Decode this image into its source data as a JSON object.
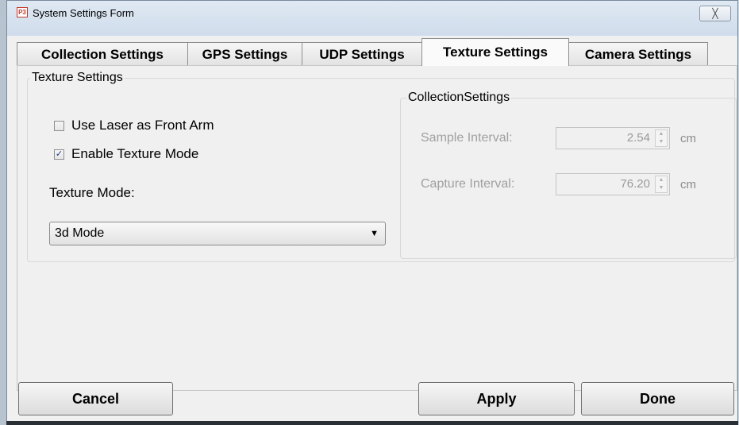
{
  "window": {
    "title": "System Settings Form",
    "app_icon_text": "P3",
    "close_glyph": "╳"
  },
  "tabs": [
    {
      "label": "Collection Settings",
      "active": false
    },
    {
      "label": "GPS Settings",
      "active": false
    },
    {
      "label": "UDP Settings",
      "active": false
    },
    {
      "label": "Texture Settings",
      "active": true
    },
    {
      "label": "Camera Settings",
      "active": false
    }
  ],
  "texture_group": {
    "legend": "Texture Settings",
    "use_laser": {
      "label": "Use Laser as Front Arm",
      "checked": false
    },
    "enable_texture": {
      "label": "Enable Texture Mode",
      "checked": true,
      "check_glyph": "✓"
    },
    "mode_label": "Texture Mode:",
    "mode_value": "3d Mode",
    "dropdown_glyph": "▼"
  },
  "collection_group": {
    "legend": "CollectionSettings",
    "sample": {
      "label": "Sample Interval:",
      "value": "2.54",
      "unit": "cm"
    },
    "capture": {
      "label": "Capture Interval:",
      "value": "76.20",
      "unit": "cm"
    },
    "spin_up": "▲",
    "spin_down": "▼"
  },
  "buttons": {
    "cancel": "Cancel",
    "apply": "Apply",
    "done": "Done"
  }
}
